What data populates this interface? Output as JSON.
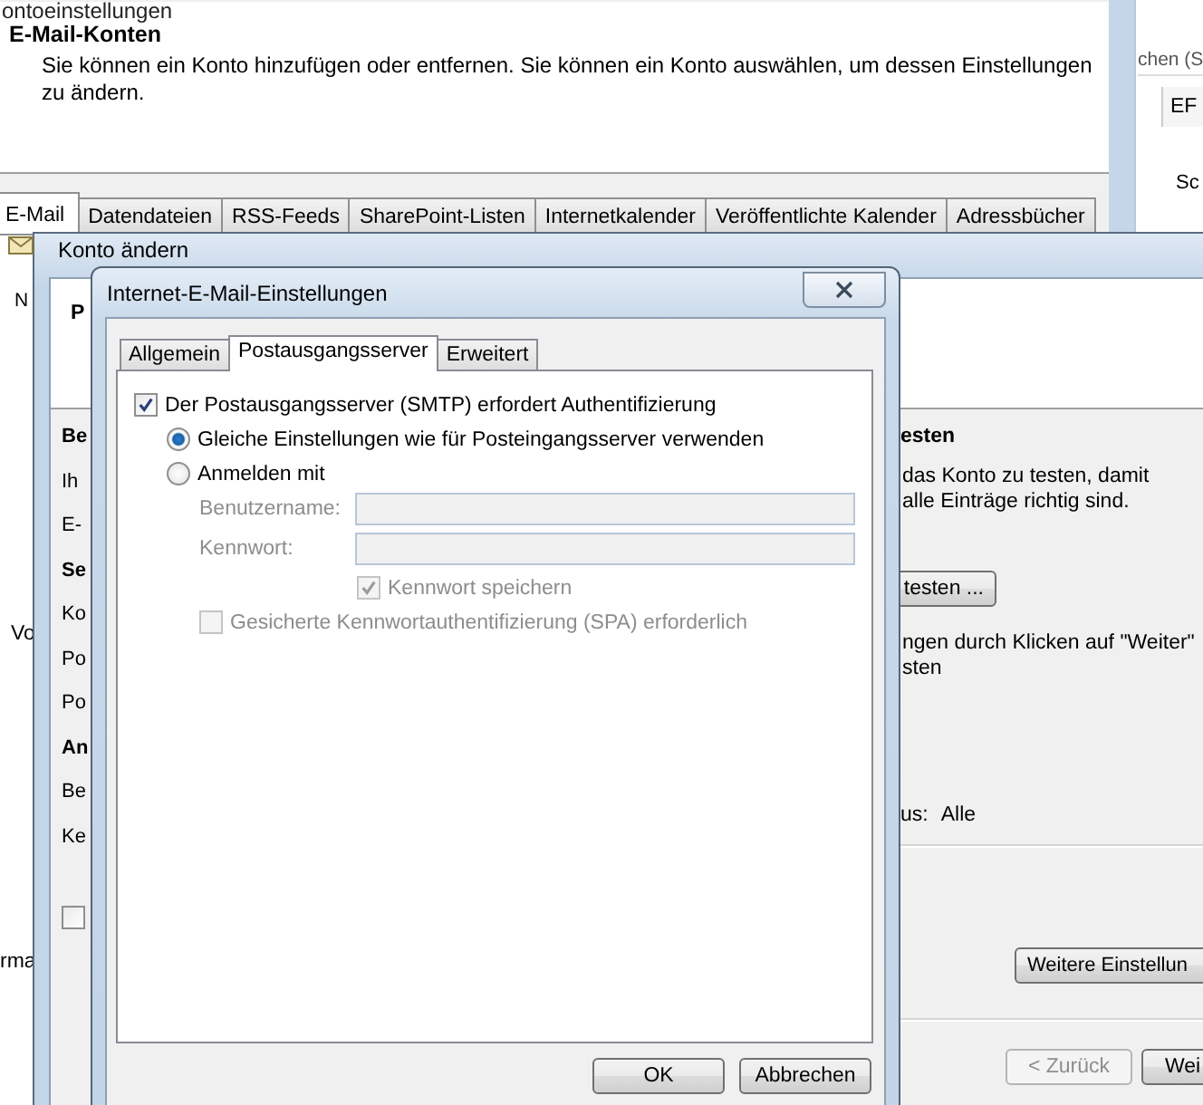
{
  "account_settings_window": {
    "title": "ontoeinstellungen",
    "heading": "E-Mail-Konten",
    "description": "Sie können ein Konto hinzufügen oder entfernen. Sie können ein Konto auswählen, um dessen Einstellungen zu ändern.",
    "tabs": [
      {
        "label": "E-Mail",
        "selected": true
      },
      {
        "label": "Datendateien",
        "selected": false
      },
      {
        "label": "RSS-Feeds",
        "selected": false
      },
      {
        "label": "SharePoint-Listen",
        "selected": false
      },
      {
        "label": "Internetkalender",
        "selected": false
      },
      {
        "label": "Veröffentlichte Kalender",
        "selected": false
      },
      {
        "label": "Adressbücher",
        "selected": false
      }
    ],
    "side_texts": [
      "N",
      "Vo",
      "rma"
    ]
  },
  "right_app": {
    "search_placeholder": "chen (S",
    "column_1": "EF",
    "text": "Sc"
  },
  "change_account_window": {
    "title": "Konto ändern",
    "header_text": "P",
    "left_labels": [
      {
        "text": "Be",
        "kind": "heading"
      },
      {
        "text": "Ih",
        "kind": "label"
      },
      {
        "text": "E-",
        "kind": "label"
      },
      {
        "text": "Se",
        "kind": "heading"
      },
      {
        "text": "Ko",
        "kind": "label"
      },
      {
        "text": "Po",
        "kind": "label"
      },
      {
        "text": "Po",
        "kind": "label"
      },
      {
        "text": "An",
        "kind": "heading"
      },
      {
        "text": "Be",
        "kind": "label"
      },
      {
        "text": "Ke",
        "kind": "label"
      }
    ],
    "checkbox": {
      "checked": false
    },
    "test_heading": "esten",
    "test_lines": [
      "das Konto zu testen, damit",
      "alle Einträge richtig sind."
    ],
    "test_button": "testen ...",
    "next_lines": [
      "ngen durch Klicken auf \"Weiter\"",
      "sten"
    ],
    "status_label": "us:",
    "status_value": "Alle",
    "more_button": "Weitere Einstellun",
    "nav_buttons": [
      {
        "label": "< Zurück",
        "disabled": true
      },
      {
        "label": "Wei",
        "disabled": false
      }
    ]
  },
  "mail_settings_dialog": {
    "title": "Internet-E-Mail-Einstellungen",
    "tabs": [
      {
        "label": "Allgemein",
        "selected": false
      },
      {
        "label": "Postausgangsserver",
        "selected": true
      },
      {
        "label": "Erweitert",
        "selected": false
      }
    ],
    "smtp_auth": {
      "label": "Der Postausgangsserver (SMTP) erfordert Authentifizierung",
      "checked": true
    },
    "auth_options": [
      {
        "label": "Gleiche Einstellungen wie für Posteingangsserver verwenden",
        "selected": true
      },
      {
        "label": "Anmelden mit",
        "selected": false
      }
    ],
    "fields": [
      {
        "label": "Benutzername:",
        "disabled": true
      },
      {
        "label": "Kennwort:",
        "disabled": true
      }
    ],
    "save_password": {
      "label": "Kennwort speichern",
      "checked": true,
      "disabled": true
    },
    "spa": {
      "label": "Gesicherte Kennwortauthentifizierung (SPA) erforderlich",
      "checked": false,
      "disabled": true
    },
    "buttons": [
      "OK",
      "Abbrechen"
    ]
  }
}
